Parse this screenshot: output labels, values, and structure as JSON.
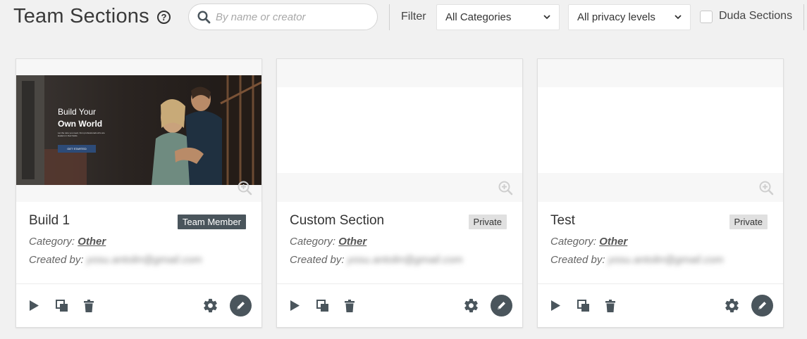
{
  "header": {
    "title": "Team Sections",
    "help_icon": "?",
    "search_placeholder": "By name or creator",
    "filter_label": "Filter",
    "category_select": "All Categories",
    "privacy_select": "All privacy levels",
    "duda_checkbox_label": "Duda Sections"
  },
  "cards": [
    {
      "name": "Build 1",
      "badge": "Team Member",
      "category_label": "Category:",
      "category_value": "Other",
      "created_label": "Created by:",
      "creator": "yosu.antolin@gmail.com",
      "thumb": {
        "heading1": "Build Your",
        "heading2": "Own World",
        "sub": "Let the care you need, from professionals who are leaders in their fields.",
        "cta": "GET STARTED"
      }
    },
    {
      "name": "Custom Section",
      "badge": "Private",
      "category_label": "Category:",
      "category_value": "Other",
      "created_label": "Created by:",
      "creator": "yosu.antolin@gmail.com"
    },
    {
      "name": "Test",
      "badge": "Private",
      "category_label": "Category:",
      "category_value": "Other",
      "created_label": "Created by:",
      "creator": "yosu.antolin@gmail.com"
    }
  ],
  "colors": {
    "background": "#f1f1f1",
    "dark_badge": "#4a555c",
    "private_badge": "#e0e0e0",
    "icon": "#4a555c"
  },
  "icons": [
    "help-icon",
    "search-icon",
    "chevron-down-icon",
    "zoom-in-icon",
    "play-icon",
    "duplicate-icon",
    "trash-icon",
    "gear-icon",
    "pencil-icon"
  ]
}
